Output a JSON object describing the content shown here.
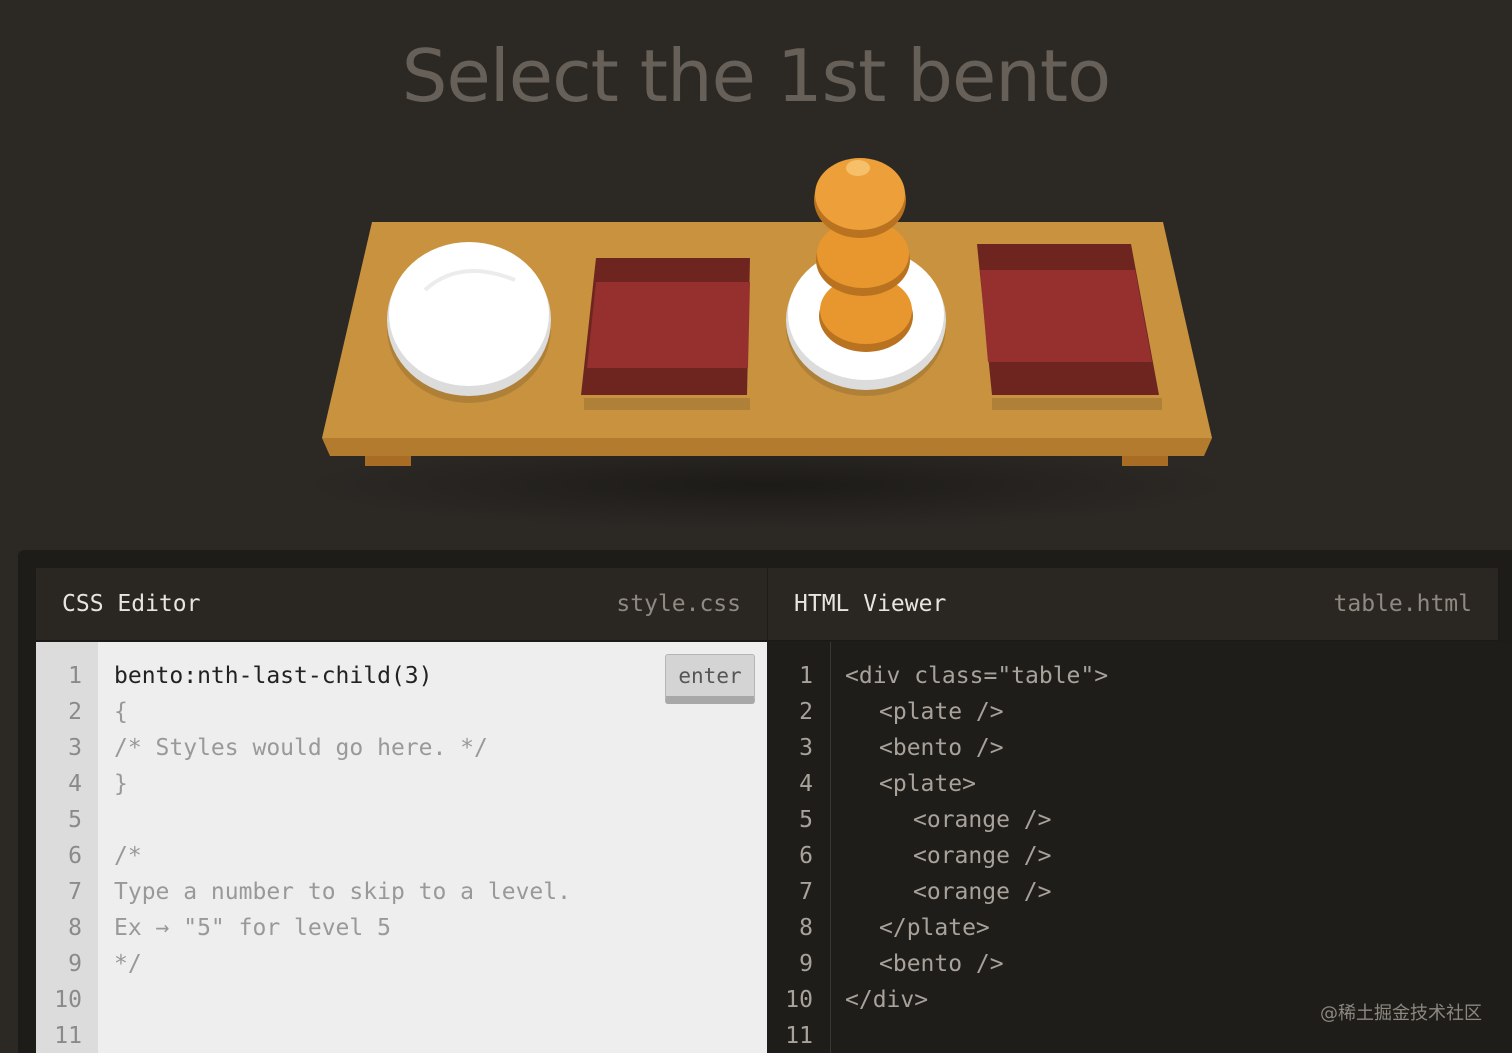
{
  "title": "Select the 1st bento",
  "table_items": [
    "plate",
    "bento",
    "plate-with-oranges",
    "bento"
  ],
  "css_editor": {
    "header": "CSS Editor",
    "file": "style.css",
    "input_value": "bento:nth-last-child(3)",
    "enter_label": "enter",
    "line_numbers": [
      "1",
      "2",
      "3",
      "4",
      "5",
      "6",
      "7",
      "8",
      "9",
      "10",
      "11"
    ],
    "lines": [
      "{",
      "/* Styles would go here. */",
      "}",
      "",
      "/*",
      "Type a number to skip to a level.",
      "Ex → \"5\" for level 5",
      "*/",
      "",
      ""
    ]
  },
  "html_viewer": {
    "header": "HTML Viewer",
    "file": "table.html",
    "line_numbers": [
      "1",
      "2",
      "3",
      "4",
      "5",
      "6",
      "7",
      "8",
      "9",
      "10",
      "11"
    ],
    "lines": [
      "<div class=\"table\">",
      "<plate />",
      "<bento />",
      "<plate>",
      "<orange />",
      "<orange />",
      "<orange />",
      "</plate>",
      "<bento />",
      "</div>",
      ""
    ]
  },
  "watermark": "@稀土掘金技术社区",
  "colors": {
    "background": "#2c2925",
    "table": "#c8923f",
    "bento": "#96302e",
    "orange": "#e8972f",
    "plate": "#ffffff"
  }
}
